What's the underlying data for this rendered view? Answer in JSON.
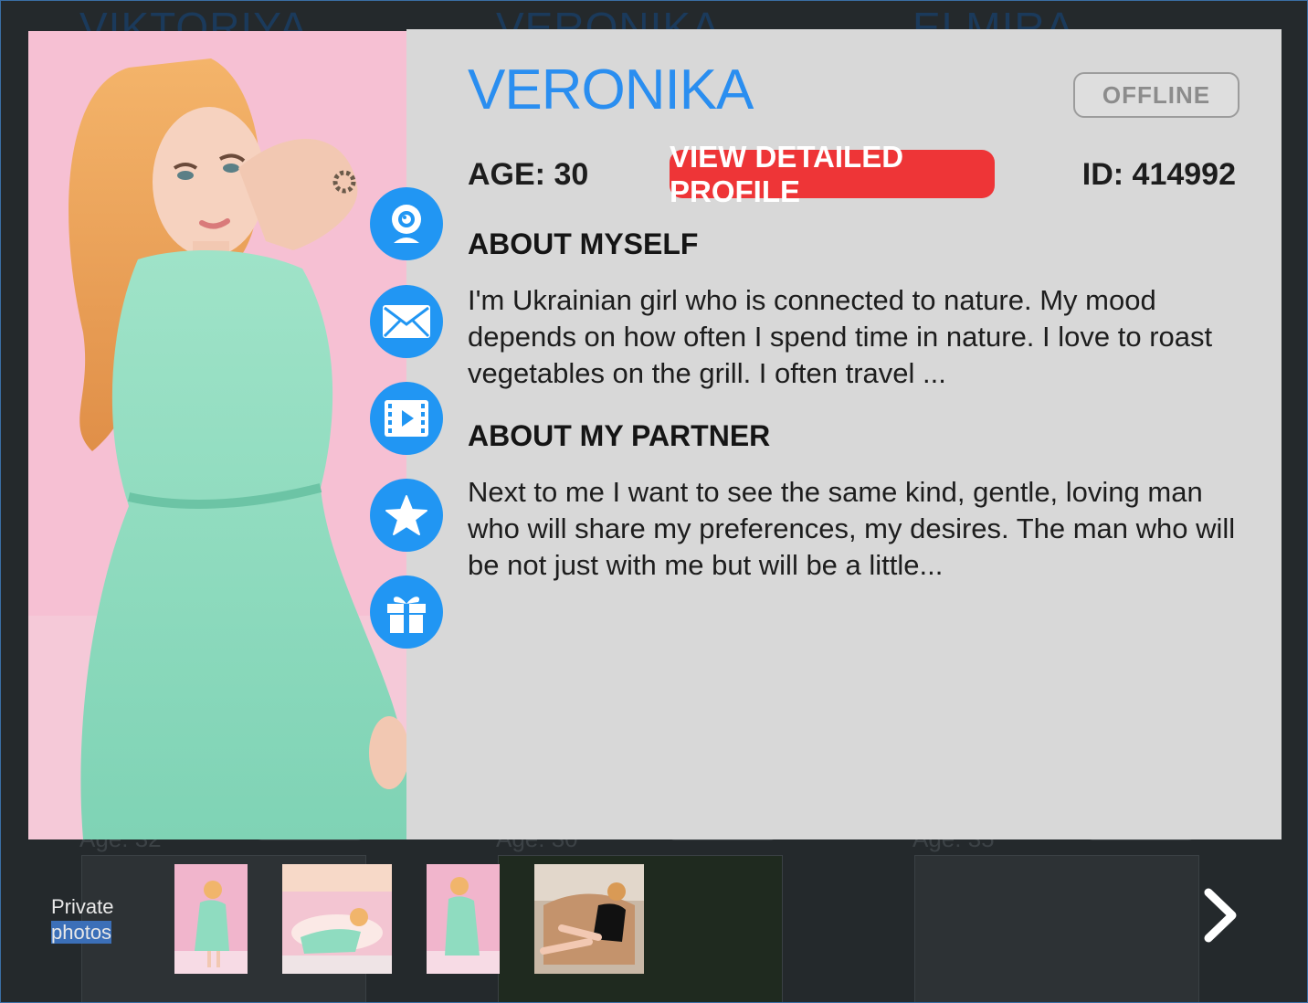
{
  "background_cards": [
    {
      "name": "VIKTORIYA",
      "age": "Age: 32"
    },
    {
      "name": "VERONIKA",
      "age": "Age: 30"
    },
    {
      "name": "ELMIRA",
      "age": "Age: 35"
    }
  ],
  "profile": {
    "name": "VERONIKA",
    "status": "OFFLINE",
    "age_text": "AGE: 30",
    "detail_button": "VIEW DETAILED PROFILE",
    "id_text": "ID: 414992",
    "about_myself_heading": "ABOUT MYSELF",
    "about_myself_text": "I'm Ukrainian girl who is connected to nature. My mood depends on how often I spend time in nature. I love to roast vegetables on the grill. I often travel ...",
    "about_partner_heading": "ABOUT MY PARTNER",
    "about_partner_text": "Next to me I want to see the same kind, gentle, loving man who will share my preferences, my desires. The man who will be not just with me but will be a little..."
  },
  "actions": [
    {
      "icon": "webcam-icon"
    },
    {
      "icon": "mail-icon"
    },
    {
      "icon": "video-icon"
    },
    {
      "icon": "star-icon"
    },
    {
      "icon": "gift-icon"
    }
  ],
  "photo_strip": {
    "label_line1": "Private",
    "label_line2": "photos",
    "thumbnails": 4
  },
  "colors": {
    "accent_blue": "#2196f3",
    "name_blue": "#2a8ef0",
    "button_red": "#ee3537",
    "panel_gray": "#d8d8d8"
  }
}
